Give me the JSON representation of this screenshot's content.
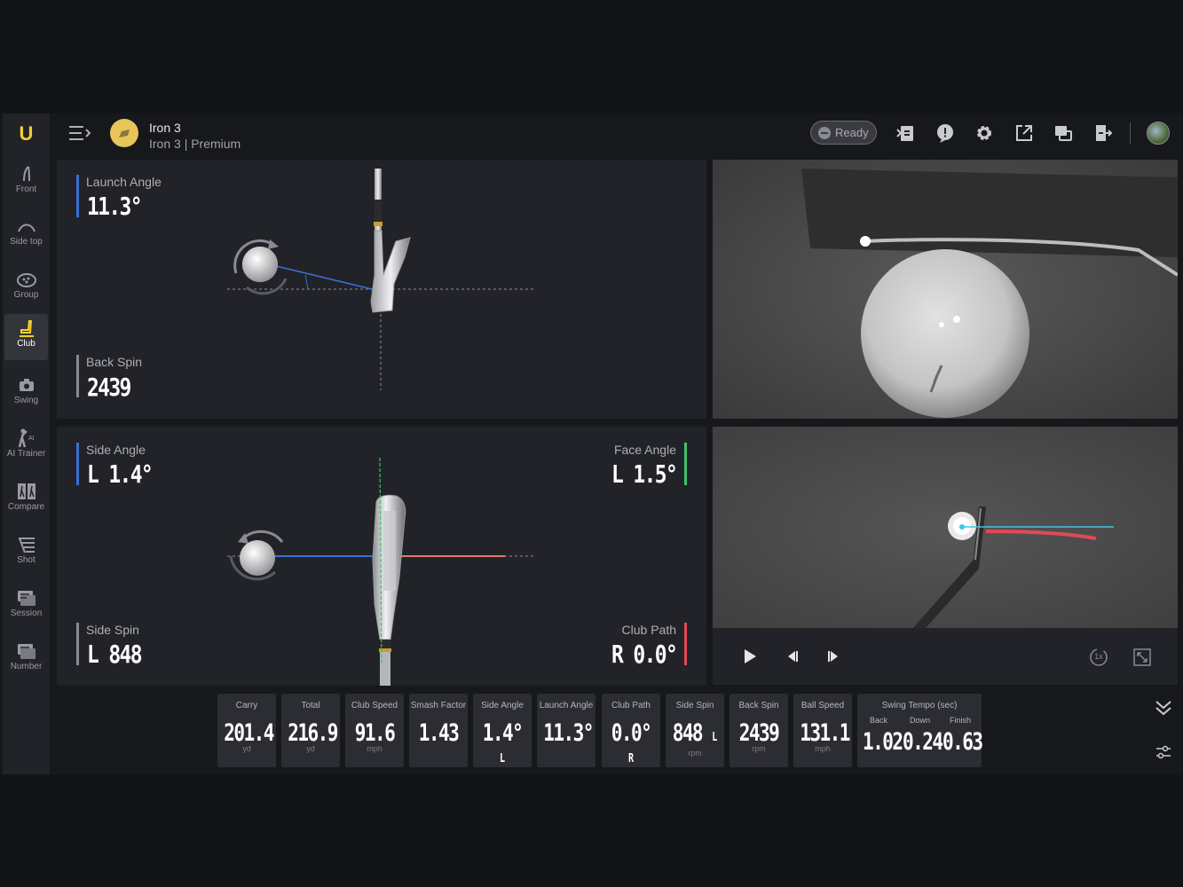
{
  "sidebar": {
    "logo": "U",
    "items": [
      {
        "label": "Front"
      },
      {
        "label": "Side top"
      },
      {
        "label": "Group"
      },
      {
        "label": "Club",
        "active": true
      },
      {
        "label": "Swing"
      },
      {
        "label": "AI Trainer"
      },
      {
        "label": "Compare"
      },
      {
        "label": "Shot"
      },
      {
        "label": "Session"
      },
      {
        "label": "Number"
      }
    ]
  },
  "header": {
    "club_title": "Iron 3",
    "club_subtitle": "Iron 3 | Premium",
    "status": "Ready",
    "icons": [
      "report-icon",
      "alert-icon",
      "settings-icon",
      "export-icon",
      "window-icon",
      "exit-icon"
    ]
  },
  "top_panel": {
    "launch_angle": {
      "label": "Launch Angle",
      "value": "11.3°"
    },
    "back_spin": {
      "label": "Back Spin",
      "value": "2439"
    }
  },
  "bottom_panel": {
    "side_angle": {
      "label": "Side Angle",
      "value": "L 1.4°"
    },
    "face_angle": {
      "label": "Face Angle",
      "value": "L 1.5°"
    },
    "side_spin": {
      "label": "Side Spin",
      "value": "L 848"
    },
    "club_path": {
      "label": "Club Path",
      "value": "R 0.0°"
    }
  },
  "stats": [
    {
      "title": "Carry",
      "value": "201.4",
      "suffix": "",
      "unit": "yd"
    },
    {
      "title": "Total",
      "value": "216.9",
      "suffix": "",
      "unit": "yd"
    },
    {
      "title": "Club Speed",
      "value": "91.6",
      "suffix": "",
      "unit": "mph"
    },
    {
      "title": "Smash Factor",
      "value": "1.43",
      "suffix": "",
      "unit": ""
    },
    {
      "title": "Side Angle",
      "value": "1.4°",
      "suffix": "L",
      "unit": ""
    },
    {
      "title": "Launch Angle",
      "value": "11.3°",
      "suffix": "",
      "unit": ""
    },
    {
      "title": "Club Path",
      "value": "0.0°",
      "suffix": "R",
      "unit": ""
    },
    {
      "title": "Side Spin",
      "value": "848",
      "suffix": "L",
      "unit": "rpm"
    },
    {
      "title": "Back Spin",
      "value": "2439",
      "suffix": "",
      "unit": "rpm"
    },
    {
      "title": "Ball Speed",
      "value": "131.1",
      "suffix": "",
      "unit": "mph"
    }
  ],
  "swing_tempo": {
    "title": "Swing Tempo (sec)",
    "back_label": "Back",
    "back_value": "1.02",
    "down_label": "Down",
    "down_value": "0.24",
    "finish_label": "Finish",
    "finish_value": "0.63"
  },
  "player": {
    "speed": "1x"
  },
  "colors": {
    "accent": "#f4cf2e",
    "launch_bar": "#3b6fd8",
    "face_bar": "#3fc26a",
    "path_bar": "#e04a55"
  }
}
